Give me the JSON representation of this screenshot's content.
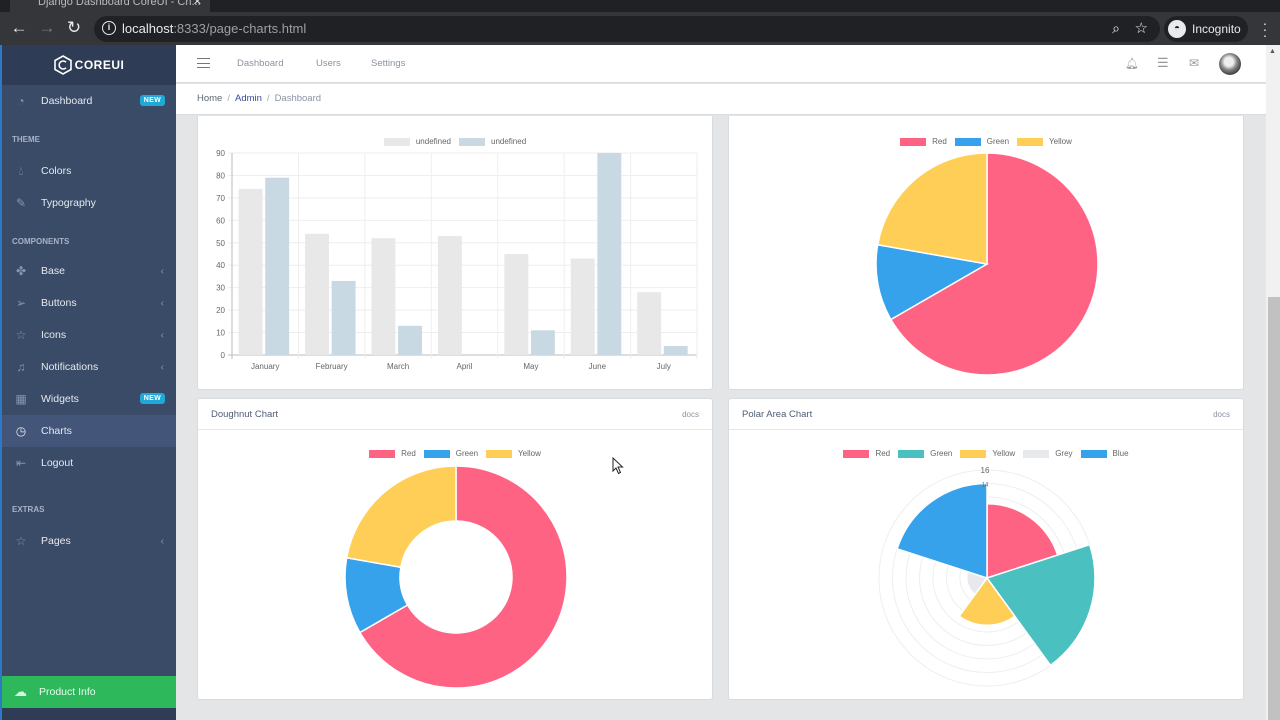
{
  "browser": {
    "tab_title": "Django Dashboard CoreUI - Ch...",
    "url_host": "localhost",
    "url_rest": ":8333/page-charts.html",
    "profile_label": "Incognito"
  },
  "sidebar": {
    "brand": "COREUI",
    "items": [
      {
        "type": "item",
        "label": "Dashboard",
        "icon": "speedometer-icon",
        "badge": "NEW"
      },
      {
        "type": "title",
        "label": "THEME"
      },
      {
        "type": "item",
        "label": "Colors",
        "icon": "drop-icon"
      },
      {
        "type": "item",
        "label": "Typography",
        "icon": "pencil-icon"
      },
      {
        "type": "title",
        "label": "COMPONENTS"
      },
      {
        "type": "item",
        "label": "Base",
        "icon": "puzzle-icon",
        "chevron": true
      },
      {
        "type": "item",
        "label": "Buttons",
        "icon": "cursor-icon",
        "chevron": true
      },
      {
        "type": "item",
        "label": "Icons",
        "icon": "star-icon",
        "chevron": true
      },
      {
        "type": "item",
        "label": "Notifications",
        "icon": "bell-icon",
        "chevron": true
      },
      {
        "type": "item",
        "label": "Widgets",
        "icon": "calculator-icon",
        "badge": "NEW"
      },
      {
        "type": "item",
        "label": "Charts",
        "icon": "pie-chart-icon",
        "active": true
      },
      {
        "type": "item",
        "label": "Logout",
        "icon": "logout-icon"
      },
      {
        "type": "title",
        "label": "EXTRAS"
      },
      {
        "type": "item",
        "label": "Pages",
        "icon": "star-icon",
        "chevron": true
      }
    ],
    "footer_button": "Product Info"
  },
  "header": {
    "links": [
      "Dashboard",
      "Users",
      "Settings"
    ]
  },
  "breadcrumb": {
    "items": [
      "Home",
      "Admin",
      "Dashboard"
    ]
  },
  "colors": {
    "red": "#ff6384",
    "blue": "#36a2eb",
    "yellow": "#ffce56",
    "teal": "#4bc0c0",
    "grey": "#e7e9ed",
    "bar1": "#e8e8e8",
    "bar2": "#c8d9e3"
  },
  "cards": {
    "bar": {
      "title": ""
    },
    "pie": {
      "title": ""
    },
    "doughnut": {
      "title": "Doughnut Chart",
      "docs": "docs"
    },
    "polar": {
      "title": "Polar Area Chart",
      "docs": "docs"
    }
  },
  "chart_data": [
    {
      "id": "bar",
      "type": "bar",
      "title": "",
      "categories": [
        "January",
        "February",
        "March",
        "April",
        "May",
        "June",
        "July"
      ],
      "series": [
        {
          "name": "undefined",
          "values": [
            74,
            54,
            52,
            53,
            45,
            43,
            28
          ]
        },
        {
          "name": "undefined",
          "values": [
            79,
            33,
            13,
            0,
            11,
            90,
            4
          ]
        }
      ],
      "ylim": [
        0,
        90
      ],
      "yticks": [
        0,
        10,
        20,
        30,
        40,
        50,
        60,
        70,
        80,
        90
      ],
      "grid": true,
      "legend": "top"
    },
    {
      "id": "pie",
      "type": "pie",
      "labels": [
        "Red",
        "Green",
        "Yellow"
      ],
      "values": [
        300,
        50,
        100
      ],
      "legend": "top"
    },
    {
      "id": "doughnut",
      "type": "pie",
      "variant": "doughnut",
      "title": "Doughnut Chart",
      "labels": [
        "Red",
        "Green",
        "Yellow"
      ],
      "values": [
        300,
        50,
        100
      ],
      "legend": "top"
    },
    {
      "id": "polar",
      "type": "pie",
      "variant": "polarArea",
      "title": "Polar Area Chart",
      "labels": [
        "Red",
        "Green",
        "Yellow",
        "Grey",
        "Blue"
      ],
      "values": [
        11,
        16,
        7,
        3,
        14
      ],
      "rmax": 16,
      "visible_tick_labels": [
        "16",
        "14"
      ],
      "legend": "top"
    }
  ]
}
